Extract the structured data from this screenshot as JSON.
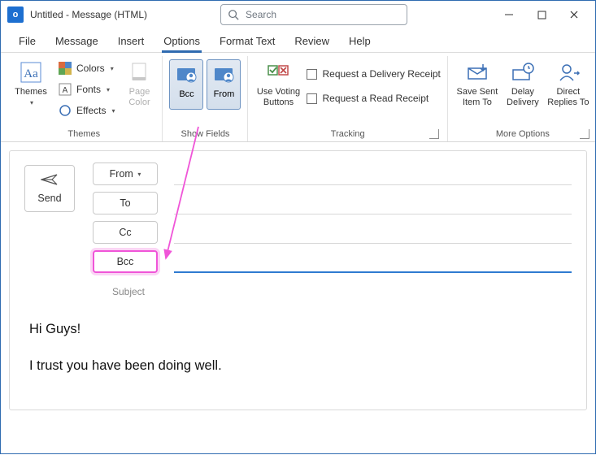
{
  "titlebar": {
    "app_letter": "o",
    "title": "Untitled  -  Message (HTML)",
    "search_placeholder": "Search"
  },
  "tabs": {
    "file": "File",
    "message": "Message",
    "insert": "Insert",
    "options": "Options",
    "format_text": "Format Text",
    "review": "Review",
    "help": "Help"
  },
  "ribbon": {
    "themes_group": "Themes",
    "themes": "Themes",
    "colors": "Colors",
    "fonts": "Fonts",
    "effects": "Effects",
    "page_color": "Page\nColor",
    "show_fields_group": "Show Fields",
    "bcc": "Bcc",
    "from": "From",
    "tracking_group": "Tracking",
    "use_voting": "Use Voting\nButtons",
    "delivery_receipt": "Request a Delivery Receipt",
    "read_receipt": "Request a Read Receipt",
    "more_options_group": "More Options",
    "save_sent": "Save Sent\nItem To",
    "delay": "Delay\nDelivery",
    "direct": "Direct\nReplies To"
  },
  "compose": {
    "send": "Send",
    "from": "From",
    "to": "To",
    "cc": "Cc",
    "bcc": "Bcc",
    "subject": "Subject",
    "body_line1": "Hi Guys!",
    "body_line2": "I trust you have been doing well."
  }
}
